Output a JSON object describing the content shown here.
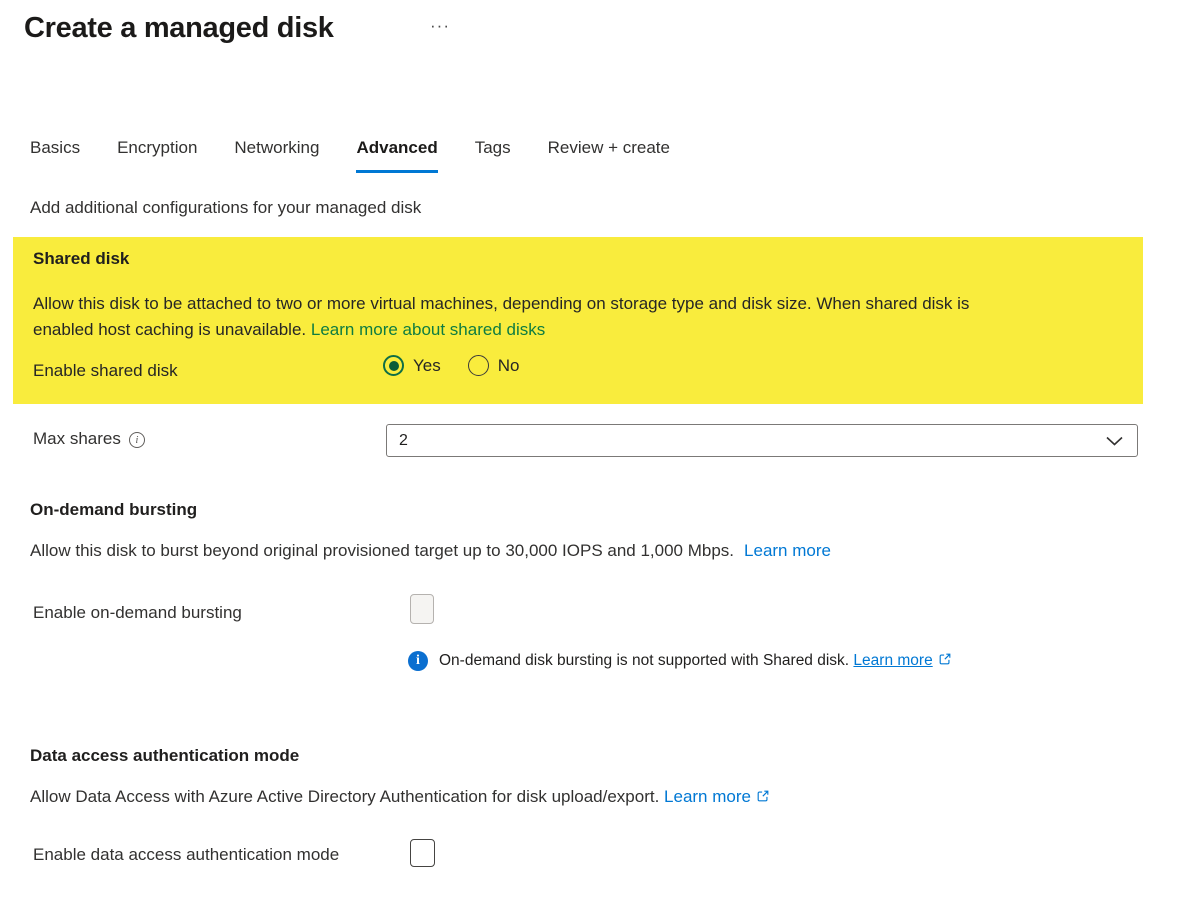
{
  "page": {
    "title": "Create a managed disk",
    "more": "···"
  },
  "tabs": [
    {
      "label": "Basics",
      "active": false
    },
    {
      "label": "Encryption",
      "active": false
    },
    {
      "label": "Networking",
      "active": false
    },
    {
      "label": "Advanced",
      "active": true
    },
    {
      "label": "Tags",
      "active": false
    },
    {
      "label": "Review + create",
      "active": false
    }
  ],
  "subtitle": "Add additional configurations for your managed disk",
  "shared_disk": {
    "heading": "Shared disk",
    "description_line1": "Allow this disk to be attached to two or more virtual machines, depending on storage type and disk size. When shared disk is",
    "description_line2": "enabled host caching is unavailable. ",
    "link_label": "Learn more about shared disks",
    "enable_label": "Enable shared disk",
    "options": [
      {
        "label": "Yes",
        "selected": true
      },
      {
        "label": "No",
        "selected": false
      }
    ],
    "highlight_color": "#f9ec3d",
    "link_color": "#0e7c41"
  },
  "max_shares": {
    "label": "Max shares",
    "info_glyph": "i",
    "value": "2"
  },
  "on_demand_bursting": {
    "heading": "On-demand bursting",
    "description": "Allow this disk to burst beyond original provisioned target up to 30,000 IOPS and 1,000 Mbps.",
    "link_label": "Learn more",
    "enable_label": "Enable on-demand bursting",
    "checkbox_checked": false,
    "checkbox_disabled": true,
    "info": {
      "glyph": "i",
      "text": "On-demand disk bursting is not supported with Shared disk. ",
      "link_label": "Learn more"
    }
  },
  "data_access": {
    "heading": "Data access authentication mode",
    "description": "Allow Data Access with Azure Active Directory Authentication for disk upload/export. ",
    "link_label": "Learn more",
    "enable_label": "Enable data access authentication mode",
    "checkbox_checked": false
  },
  "colors": {
    "accent_blue": "#0078d4",
    "highlight_yellow": "#f9ec3d",
    "green_link": "#0e7c41"
  }
}
